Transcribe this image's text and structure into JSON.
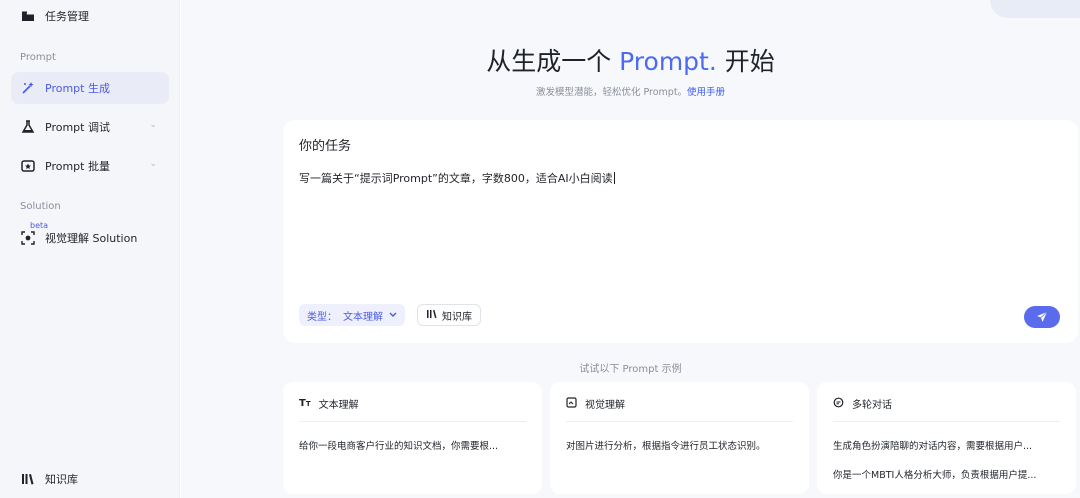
{
  "sidebar": {
    "top_item": {
      "label": "任务管理",
      "icon": "folder-icon"
    },
    "sections": [
      {
        "label": "Prompt"
      },
      {
        "label": "Solution"
      }
    ],
    "items": [
      {
        "label": "Prompt 生成",
        "icon": "magic-wand-icon",
        "active": true
      },
      {
        "label": "Prompt 调试",
        "icon": "flask-icon"
      },
      {
        "label": "Prompt 批量",
        "icon": "star-box-icon"
      },
      {
        "label": "视觉理解 Solution",
        "icon": "scan-icon",
        "badge": "beta"
      }
    ],
    "bottom_item": {
      "label": "知识库",
      "icon": "library-icon"
    }
  },
  "hero": {
    "title_pre": "从生成一个 ",
    "title_accent": "Prompt.",
    "title_post": " 开始",
    "subtitle": "激发模型潜能，轻松优化 Prompt。",
    "subtitle_link": "使用手册"
  },
  "task": {
    "title": "你的任务",
    "input_value": "写一篇关于“提示词Prompt”的文章，字数800，适合AI小白阅读",
    "type_label": "类型：",
    "type_value": "文本理解",
    "kb_label": "知识库"
  },
  "examples": {
    "label": "试试以下 Prompt 示例",
    "cards": [
      {
        "title": "文本理解",
        "icon": "text-size-icon",
        "lines": [
          "给你一段电商客户行业的知识文档，你需要根..."
        ]
      },
      {
        "title": "视觉理解",
        "icon": "image-scan-icon",
        "lines": [
          "对图片进行分析，根据指令进行员工状态识别。"
        ]
      },
      {
        "title": "多轮对话",
        "icon": "chat-icon",
        "lines": [
          "生成角色扮演陪聊的对话内容，需要根据用户...",
          "你是一个MBTI人格分析大师，负责根据用户提..."
        ]
      }
    ]
  },
  "colors": {
    "accent": "#4d6af0",
    "send": "#5b6bee",
    "active_bg": "#e9ebf7"
  }
}
